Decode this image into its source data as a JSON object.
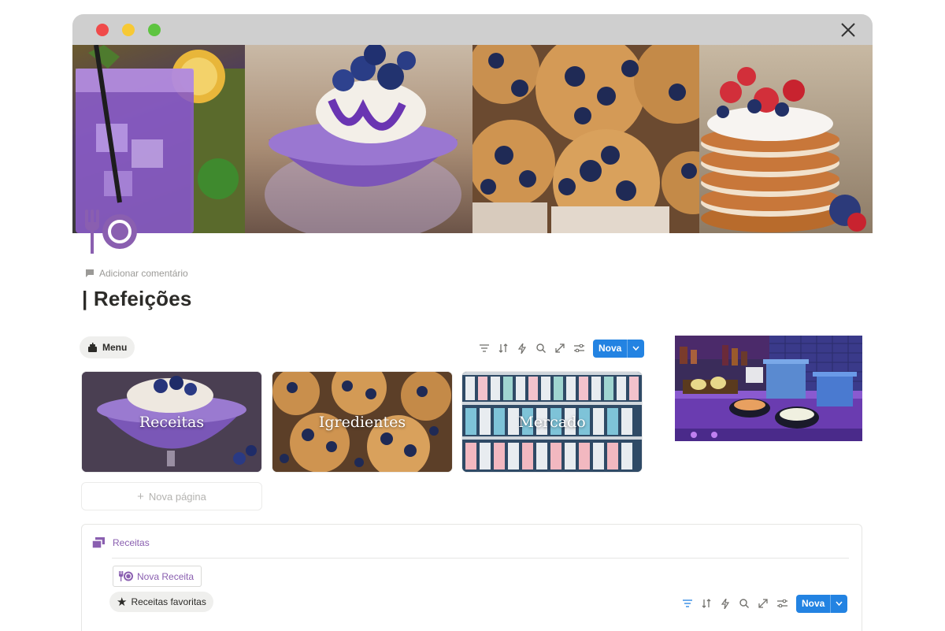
{
  "page": {
    "title": "| Refeições",
    "comment_label": "Adicionar comentário"
  },
  "menu": {
    "label": "Menu"
  },
  "toolbar": {
    "new_label": "Nova"
  },
  "gallery": {
    "cards": [
      {
        "label": "Receitas"
      },
      {
        "label": "Igredientes"
      },
      {
        "label": "Mercado"
      }
    ],
    "new_page_label": "Nova página"
  },
  "database": {
    "title": "Receitas",
    "new_recipe_label": "Nova Receita",
    "favorites_label": "Receitas favoritas",
    "new_label": "Nova"
  },
  "icons": {
    "page_icon": "fork-plate-icon",
    "comment": "comment-icon",
    "menu": "menu-cake-icon",
    "filter": "filter-icon",
    "sort": "sort-icon",
    "automation": "lightning-icon",
    "search": "search-icon",
    "expand": "expand-icon",
    "settings": "settings-sliders-icon",
    "database": "database-icon",
    "favorites": "star-icon"
  },
  "colors": {
    "accent_purple": "#8a5fb0",
    "primary_blue": "#2383e2",
    "titlebar": "#cfcfcf"
  }
}
